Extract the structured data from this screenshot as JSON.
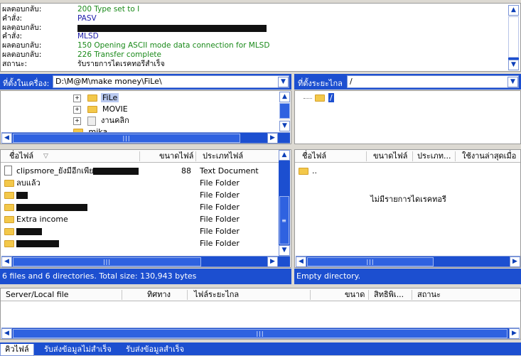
{
  "log": [
    {
      "label": "ผลตอบกลับ:",
      "text": "200 Type set to I",
      "color": "#1a8a1a"
    },
    {
      "label": "คำสั่ง:",
      "text": "PASV",
      "color": "#1a1aa8"
    },
    {
      "label": "ผลตอบกลับ:",
      "text": "",
      "color": "#1a8a1a"
    },
    {
      "label": "คำสั่ง:",
      "text": "MLSD",
      "color": "#1a1aa8"
    },
    {
      "label": "ผลตอบกลับ:",
      "text": "150 Opening ASCII mode data connection for MLSD",
      "color": "#1a8a1a"
    },
    {
      "label": "ผลตอบกลับ:",
      "text": "226 Transfer complete",
      "color": "#1a8a1a"
    },
    {
      "label": "สถานะ:",
      "text": "รับรายการไดเรคทอรีสำเร็จ",
      "color": "#000000"
    }
  ],
  "local": {
    "path_label": "ที่ตั้งในเครื่อง:",
    "path_value": "D:\\M@M\\make money\\FiLe\\",
    "tree": [
      {
        "name": "FiLe",
        "selected": true
      },
      {
        "name": "MOVIE",
        "selected": false
      },
      {
        "name": "งานคลิก",
        "selected": false
      },
      {
        "name": "mika",
        "selected": false
      }
    ],
    "columns": {
      "name": "ชื่อไฟล์",
      "size": "ขนาดไฟล์",
      "type": "ประเภทไฟล์"
    },
    "files": [
      {
        "name": "clipsmore_ยังมีอีกเพียบ",
        "redacted": true,
        "size": "88",
        "type": "Text Document",
        "icon": "document-icon"
      },
      {
        "name": "ลบแล้ว",
        "redacted": false,
        "size": "",
        "type": "File Folder",
        "icon": "folder-icon"
      },
      {
        "name": "",
        "redacted": true,
        "size": "",
        "type": "File Folder",
        "icon": "folder-icon"
      },
      {
        "name": "",
        "redacted": true,
        "size": "",
        "type": "File Folder",
        "icon": "folder-icon"
      },
      {
        "name": "Extra income",
        "redacted": false,
        "size": "",
        "type": "File Folder",
        "icon": "folder-icon"
      },
      {
        "name": "",
        "redacted": true,
        "size": "",
        "type": "File Folder",
        "icon": "folder-icon"
      },
      {
        "name": "",
        "redacted": true,
        "size": "",
        "type": "File Folder",
        "icon": "folder-icon"
      }
    ],
    "status": "6 files and 6 directories. Total size: 130,943 bytes"
  },
  "remote": {
    "path_label": "ที่ตั้งระยะไกล",
    "path_value": "/",
    "tree_root": "/",
    "columns": {
      "name": "ชื่อไฟล์",
      "size": "ขนาดไฟล์",
      "type": "ประเภท...",
      "modified": "ใช้งานล่าสุดเมื่อ"
    },
    "files": [
      {
        "name": "..",
        "icon": "folder-icon"
      }
    ],
    "empty_message": "ไม่มีรายการไดเรคทอรี",
    "status": "Empty directory."
  },
  "queue": {
    "columns": {
      "server": "Server/Local file",
      "direction": "ทิศทาง",
      "remote": "ไฟล์ระยะไกล",
      "size": "ขนาด",
      "priority": "สิทธิพิเ...",
      "status": "สถานะ"
    }
  },
  "tabs": [
    {
      "label": "คิวไฟล์",
      "active": true
    },
    {
      "label": "รับส่งข้อมูลไม่สำเร็จ",
      "active": false
    },
    {
      "label": "รับส่งข้อมูลสำเร็จ",
      "active": false
    }
  ],
  "colors": {
    "accent": "#1c4fd0",
    "log_success": "#1a8a1a",
    "log_command": "#1a1aa8"
  }
}
